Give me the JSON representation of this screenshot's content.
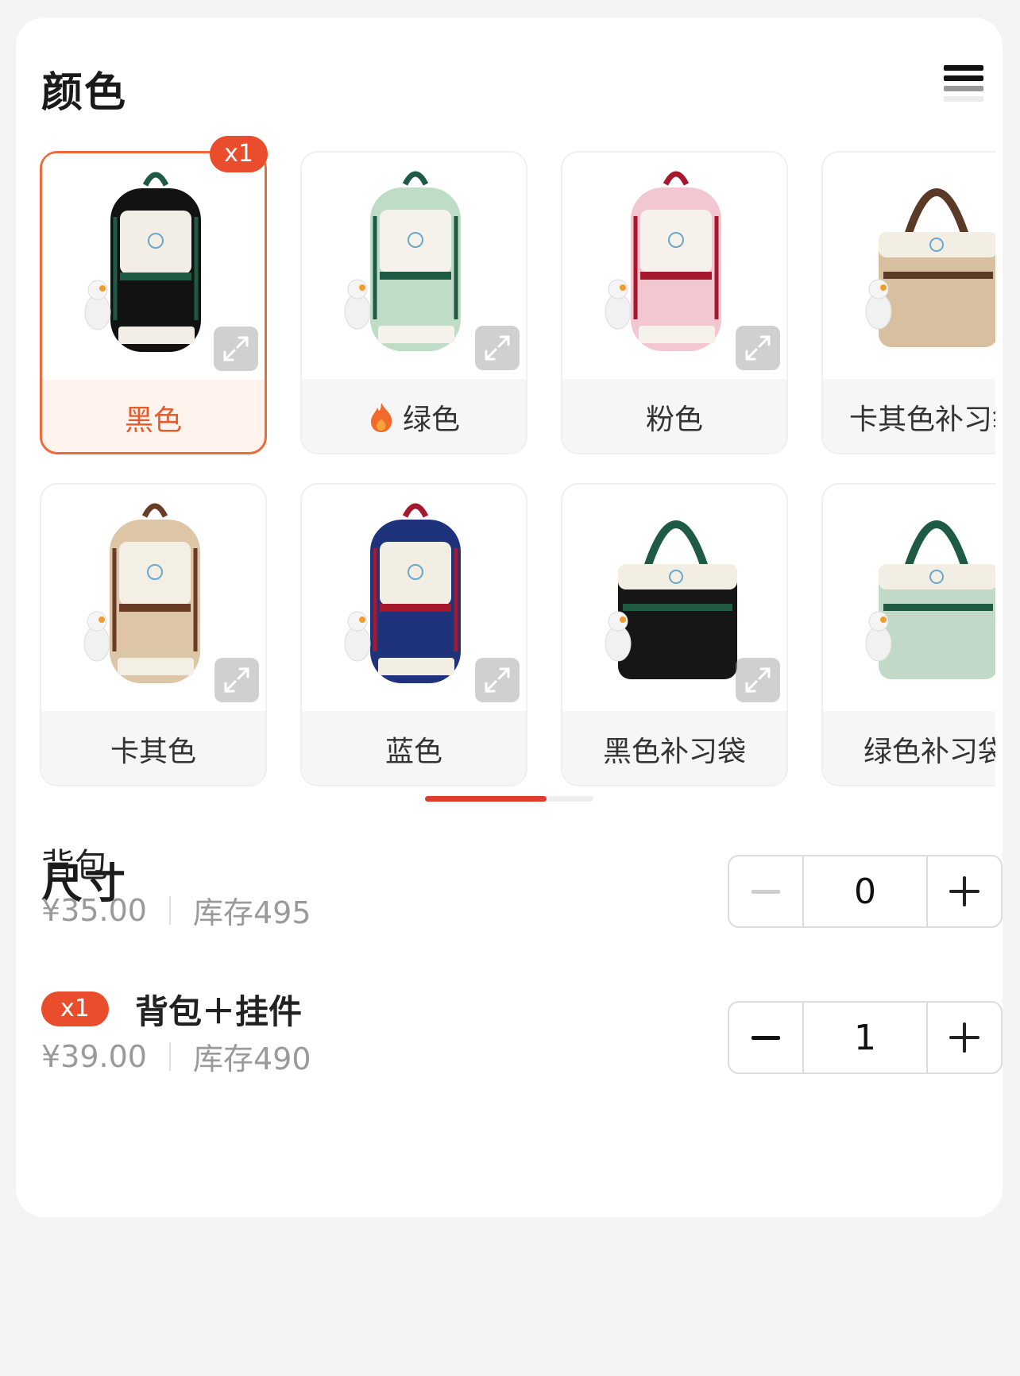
{
  "color_section": {
    "title": "颜色",
    "variants": [
      {
        "label": "黑色",
        "selected": true,
        "badge": "x1",
        "main": "#121212",
        "trim": "#1f5a45",
        "panel": "#f2eee6",
        "type": "backpack",
        "icon": "backpack-black-image"
      },
      {
        "label": "绿色",
        "selected": false,
        "hot": true,
        "main": "#bfdcc7",
        "trim": "#1f5a45",
        "panel": "#f4f2ea",
        "type": "backpack",
        "icon": "backpack-green-image"
      },
      {
        "label": "粉色",
        "selected": false,
        "main": "#f2c7d2",
        "trim": "#a5182e",
        "panel": "#f6f1ea",
        "type": "backpack",
        "icon": "backpack-pink-image"
      },
      {
        "label": "卡其色补习袋",
        "selected": false,
        "main": "#d7c0a0",
        "trim": "#5a3a26",
        "panel": "#f3eee4",
        "type": "tote",
        "icon": "tote-khaki-image"
      },
      {
        "label": "卡其色",
        "selected": false,
        "main": "#dcc6a6",
        "trim": "#6a3b25",
        "panel": "#f4efe5",
        "type": "backpack",
        "icon": "backpack-khaki-image"
      },
      {
        "label": "蓝色",
        "selected": false,
        "main": "#1f327c",
        "trim": "#a5182e",
        "panel": "#f3eee4",
        "type": "backpack",
        "icon": "backpack-blue-image"
      },
      {
        "label": "黑色补习袋",
        "selected": false,
        "main": "#161616",
        "trim": "#1f5a45",
        "panel": "#f3eee4",
        "type": "tote",
        "icon": "tote-black-image"
      },
      {
        "label": "绿色补习袋",
        "selected": false,
        "main": "#c2d9c7",
        "trim": "#1f5a45",
        "panel": "#f3eee4",
        "type": "tote",
        "icon": "tote-green-image"
      }
    ]
  },
  "size_section": {
    "title": "尺寸",
    "rows": [
      {
        "name": "背包",
        "price": "¥35.00",
        "stock": "库存495",
        "quantity": "0",
        "badge": null,
        "minus_disabled": true
      },
      {
        "name": "背包＋挂件",
        "price": "¥39.00",
        "stock": "库存490",
        "quantity": "1",
        "badge": "x1",
        "minus_disabled": false
      }
    ]
  },
  "scroll_progress": 0.72,
  "colors": {
    "accent": "#ea4d2b",
    "selected_border": "#ee6a3b",
    "selected_bg": "#fff3ee",
    "muted_text": "#9a9a9a"
  }
}
